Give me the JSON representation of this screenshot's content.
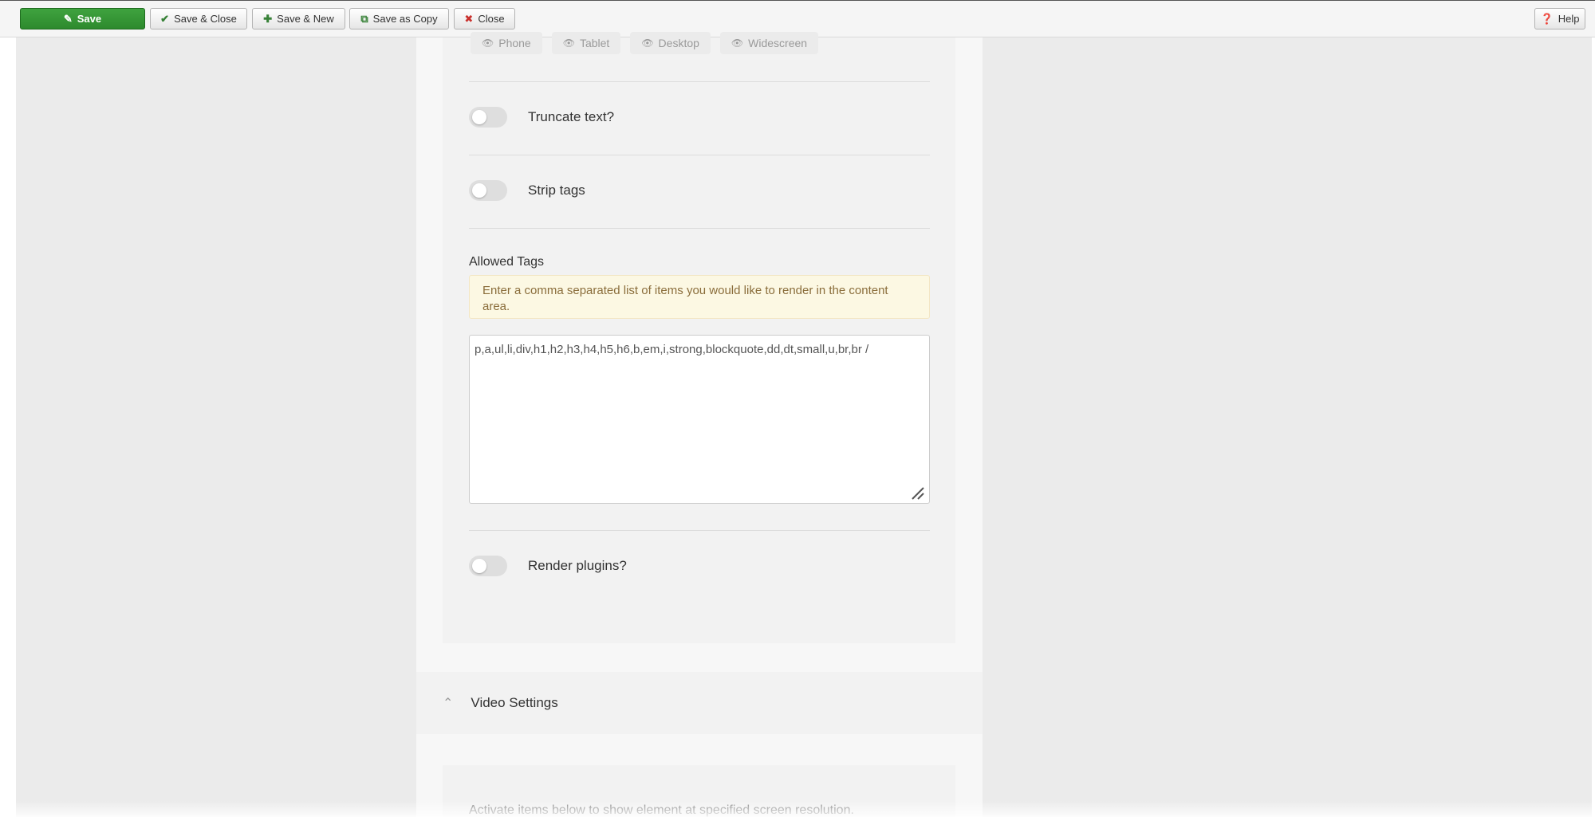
{
  "toolbar": {
    "save": {
      "label": "Save",
      "icon": "edit-icon"
    },
    "save_close": {
      "label": "Save & Close",
      "icon": "check-icon"
    },
    "save_new": {
      "label": "Save & New",
      "icon": "plus-icon"
    },
    "save_copy": {
      "label": "Save as Copy",
      "icon": "copy-icon"
    },
    "close": {
      "label": "Close",
      "icon": "close-circle-icon"
    },
    "help": {
      "label": "Help",
      "icon": "question-circle-icon"
    }
  },
  "devices": [
    "Phone",
    "Tablet",
    "Desktop",
    "Widescreen"
  ],
  "toggles": {
    "truncate": {
      "label": "Truncate text?",
      "on": false
    },
    "strip": {
      "label": "Strip tags",
      "on": false
    },
    "render_plugins": {
      "label": "Render plugins?",
      "on": false
    }
  },
  "allowed_tags": {
    "label": "Allowed Tags",
    "hint": "Enter a comma separated list of items you would like to render in the content area.",
    "value": "p,a,ul,li,div,h1,h2,h3,h4,h5,h6,b,em,i,strong,blockquote,dd,dt,small,u,br,br /"
  },
  "video_settings": {
    "title": "Video Settings"
  },
  "footnote": "Activate items below to show element at specified screen resolution.",
  "colors": {
    "save_green": "#2d8a2d",
    "alert_bg": "#fcf8e3",
    "alert_text": "#8a6d3b",
    "toggle_off": "#dedede"
  }
}
